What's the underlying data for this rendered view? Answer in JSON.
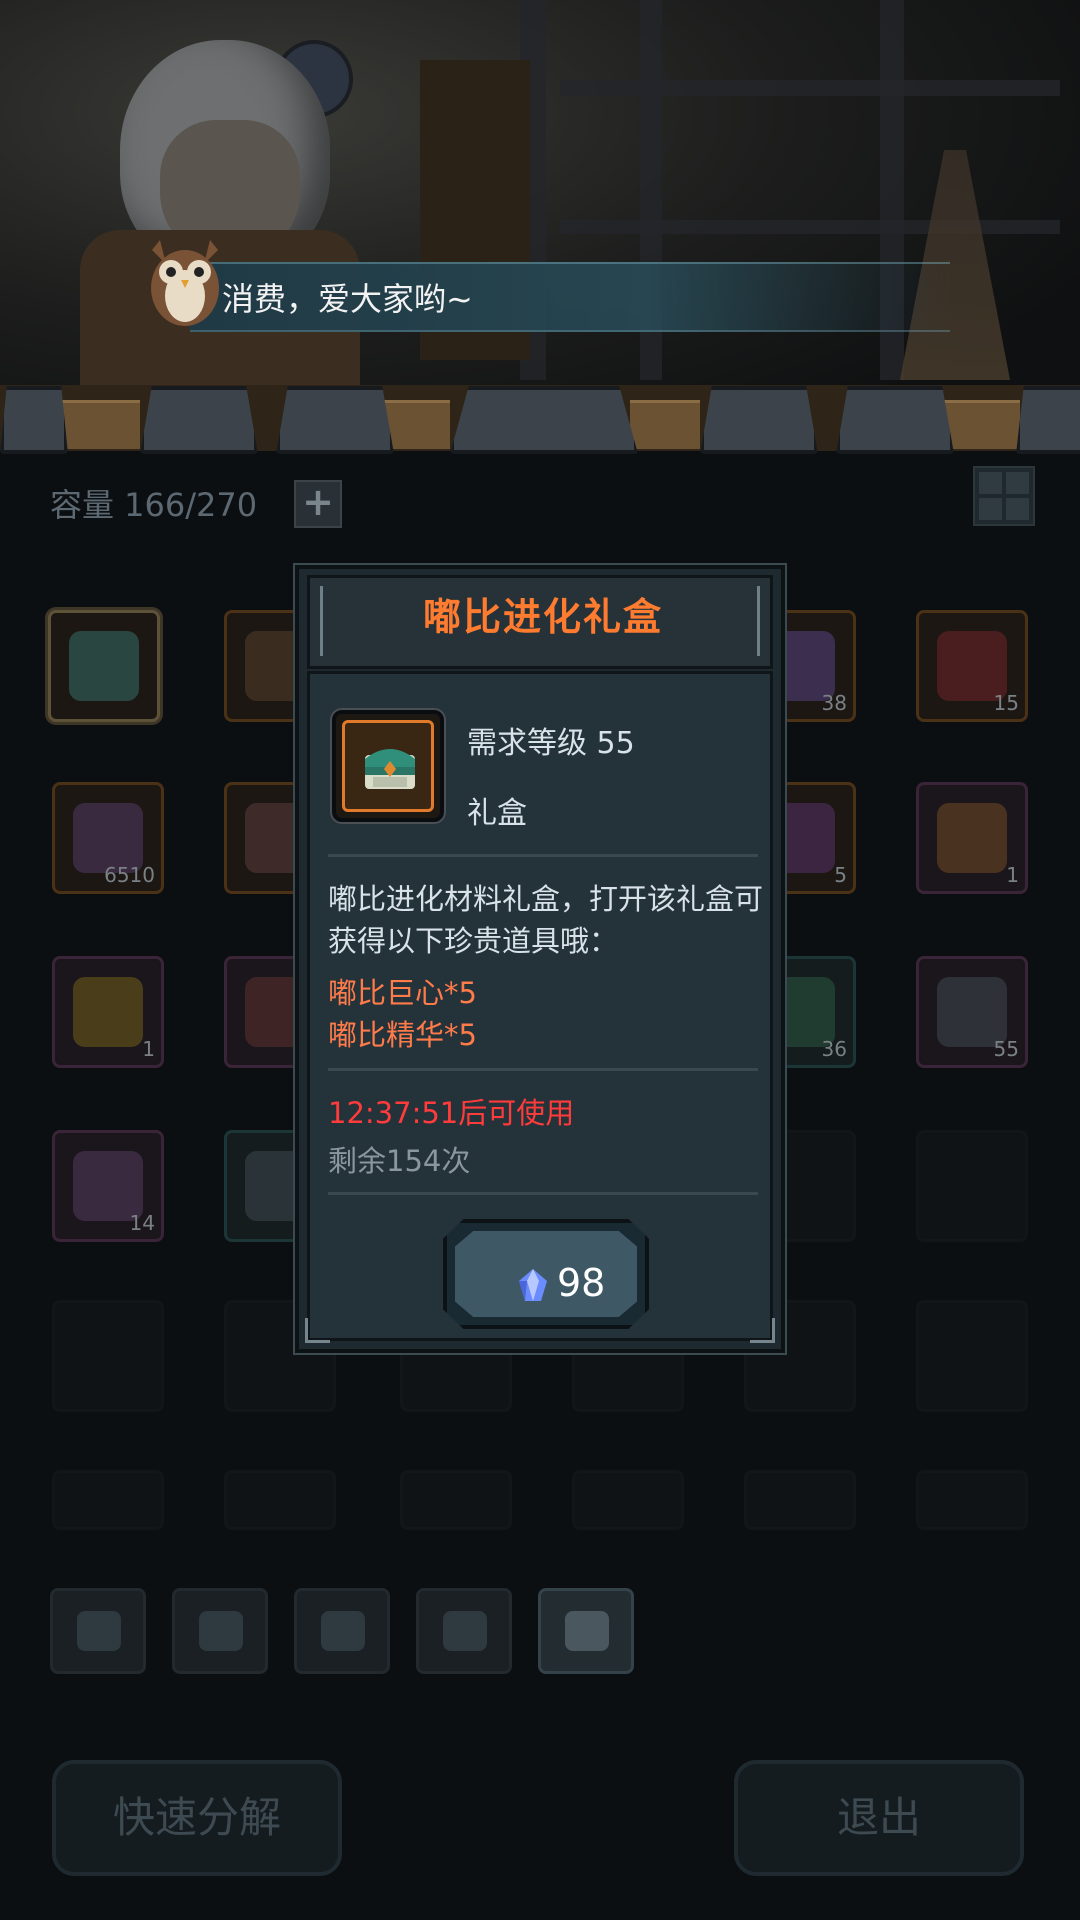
{
  "speech": {
    "text": "消费，爱大家哟~"
  },
  "inventory": {
    "capacity_label": "容量 166/270",
    "slots": [
      {
        "count": ""
      },
      {
        "count": ""
      },
      {
        "count": "38"
      },
      {
        "count": "15"
      },
      {
        "count": "6510"
      },
      {
        "count": ""
      },
      {
        "count": "5"
      },
      {
        "count": "1"
      },
      {
        "count": "1"
      },
      {
        "count": ""
      },
      {
        "count": "36"
      },
      {
        "count": "55"
      },
      {
        "count": "14"
      },
      {
        "count": ""
      }
    ],
    "categories": [
      "tools-icon",
      "paw-icon",
      "gem-icon",
      "leaf-icon",
      "chest-icon"
    ]
  },
  "bottom": {
    "decompose_label": "快速分解",
    "exit_label": "退出"
  },
  "dialog": {
    "title": "嘟比进化礼盒",
    "required_level": "需求等级 55",
    "item_type": "礼盒",
    "description": "嘟比进化材料礼盒，打开该礼盒可获得以下珍贵道具哦：",
    "rewards": [
      "嘟比巨心*5",
      "嘟比精华*5"
    ],
    "cooldown": "12:37:51后可使用",
    "remaining": "剩余154次",
    "price": "98",
    "price_icon": "crystal-icon"
  },
  "colors": {
    "title": "#ff7b2f",
    "reward": "#ff7b4a",
    "cooldown": "#ff3b3b",
    "frame_accent": "#e17a2a"
  }
}
